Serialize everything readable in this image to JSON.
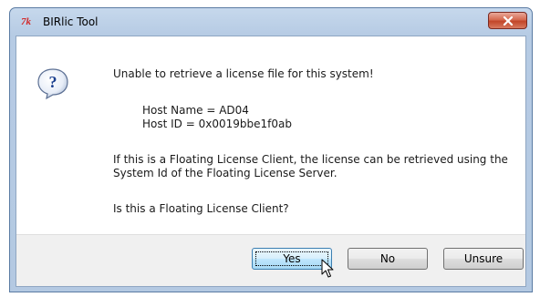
{
  "window": {
    "title": "BIRlic Tool",
    "app_icon_text": "7k",
    "icons": {
      "app": "birlic-app-icon",
      "close": "close-icon",
      "question": "question-icon",
      "cursor": "mouse-pointer-icon"
    },
    "colors": {
      "titlebar": "#b6cbe4",
      "close_button": "#c24629",
      "question_icon": "#1a3f8f",
      "focused_button_border": "#3c7fb1"
    }
  },
  "message": {
    "line1": "Unable to retrieve a license file for this system!",
    "host_name": "Host Name = AD04",
    "host_id": "Host ID = 0x0019bbe1f0ab",
    "para_line1": "If this is a Floating License Client, the license can be retrieved using the",
    "para_line2": "System Id of the Floating License Server.",
    "question": "Is this a Floating License Client?"
  },
  "buttons": {
    "yes": "Yes",
    "no": "No",
    "unsure": "Unsure"
  }
}
